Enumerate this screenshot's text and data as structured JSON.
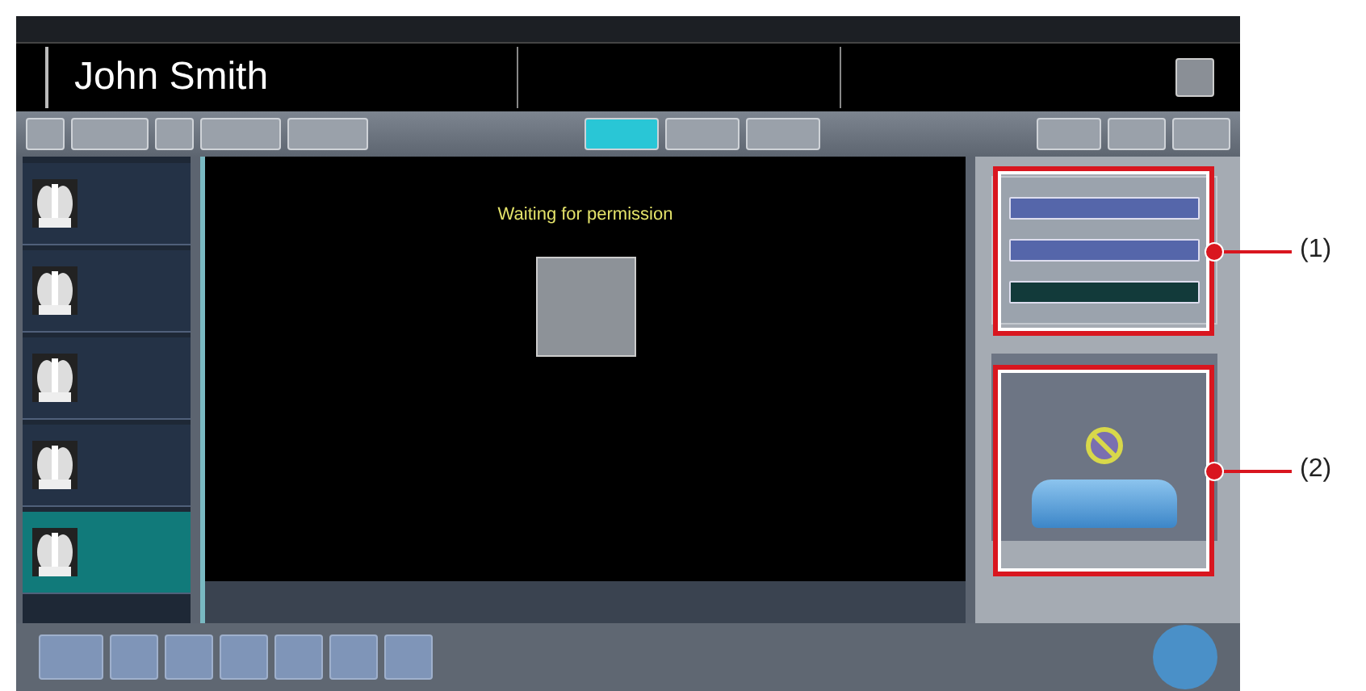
{
  "patient": {
    "name": "John Smith"
  },
  "layout_buttons": [
    {
      "selected": true
    },
    {
      "selected": false
    },
    {
      "selected": false
    }
  ],
  "thumbnails": [
    {
      "selected": false
    },
    {
      "selected": false
    },
    {
      "selected": false
    },
    {
      "selected": false
    },
    {
      "selected": true
    }
  ],
  "viewer": {
    "message": "Waiting for permission"
  },
  "panel_buttons": [
    {
      "selected": false
    },
    {
      "selected": false
    },
    {
      "selected": true
    }
  ],
  "callouts": [
    {
      "label": "(1)"
    },
    {
      "label": "(2)"
    }
  ]
}
